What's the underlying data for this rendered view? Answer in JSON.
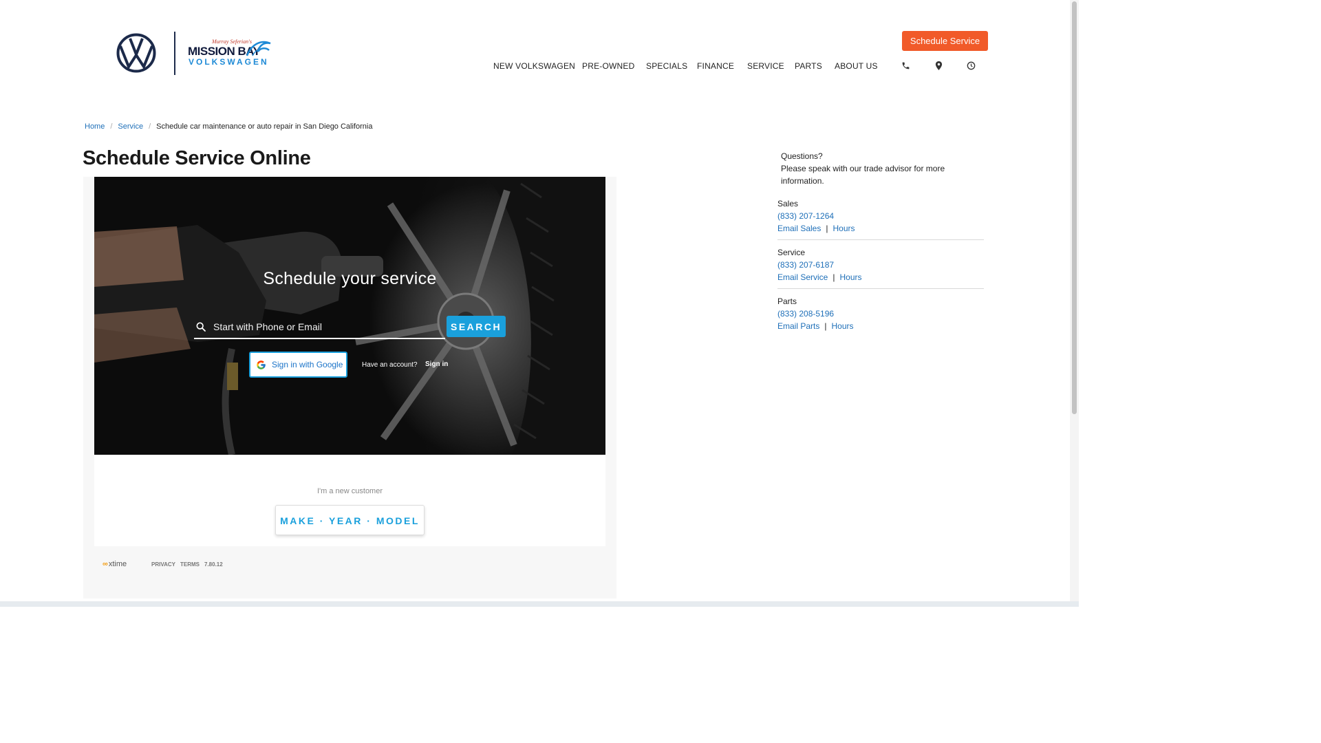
{
  "brand": {
    "dealer_line1": "MISSION BAY",
    "dealer_line2": "VOLKSWAGEN",
    "dealer_script": "Murray Seferian's"
  },
  "header": {
    "cta_label": "Schedule Service",
    "nav": [
      "NEW VOLKSWAGEN",
      "PRE-OWNED",
      "SPECIALS",
      "FINANCE",
      "SERVICE",
      "PARTS",
      "ABOUT US"
    ],
    "icons": [
      "phone-icon",
      "map-pin-icon",
      "clock-icon"
    ]
  },
  "breadcrumb": {
    "home": "Home",
    "service": "Service",
    "current": "Schedule car maintenance or auto repair in San Diego California"
  },
  "page_title": "Schedule Service Online",
  "widget": {
    "hero_title": "Schedule your service",
    "search_placeholder": "Start with Phone or Email",
    "search_button": "SEARCH",
    "google_button": "Sign in with Google",
    "have_account": "Have an account?",
    "sign_in": "Sign in",
    "new_customer": "I'm a new customer",
    "make_year_model": "MAKE · YEAR · MODEL",
    "footer_brand": "xtime",
    "footer_privacy": "PRIVACY",
    "footer_terms": "TERMS",
    "footer_version": "7.80.12"
  },
  "sidebar": {
    "questions_title": "Questions?",
    "questions_text": "Please speak with our trade advisor for more information.",
    "sales": {
      "heading": "Sales",
      "phone": "(833) 207-1264",
      "email": "Email Sales",
      "hours": "Hours"
    },
    "service": {
      "heading": "Service",
      "phone": "(833) 207-6187",
      "email": "Email Service",
      "hours": "Hours"
    },
    "parts": {
      "heading": "Parts",
      "phone": "(833) 208-5196",
      "email": "Email Parts",
      "hours": "Hours"
    }
  },
  "colors": {
    "accent_orange": "#f15a29",
    "widget_blue": "#1aa0dc",
    "link_blue": "#1e6fb8",
    "vw_navy": "#1c2a4a"
  }
}
